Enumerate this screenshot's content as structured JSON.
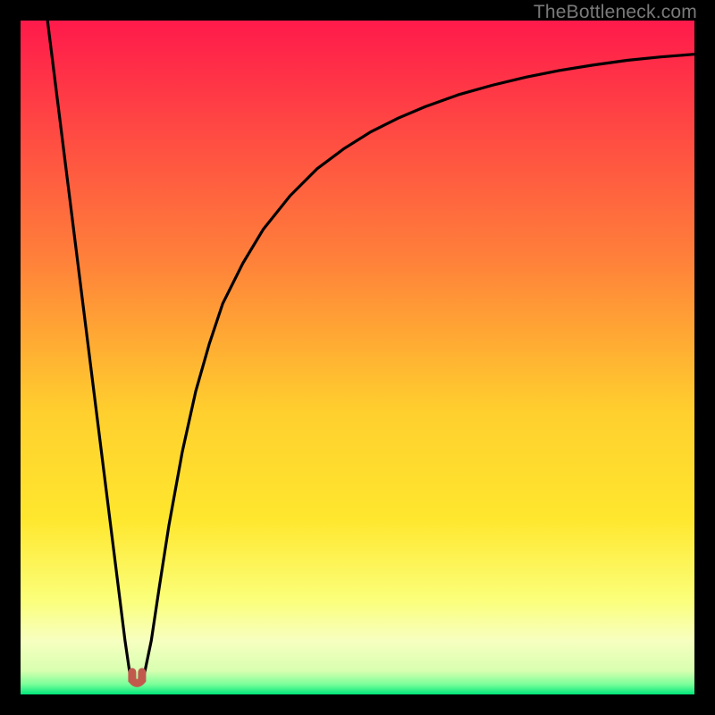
{
  "watermark": "TheBottleneck.com",
  "colors": {
    "bg_black": "#000000",
    "grad_top": "#ff1a4b",
    "grad_orange": "#ff7f3a",
    "grad_yellow": "#ffe72e",
    "grad_lightyellow": "#fbff7a",
    "grad_paleyellow": "#f7ffc0",
    "grad_green": "#00e67a",
    "curve_stroke": "#000000",
    "marker_fill": "#c15a4d",
    "marker_stroke": "#c15a4d",
    "watermark": "#7a7a7a"
  },
  "chart_data": {
    "type": "line",
    "title": "",
    "xlabel": "",
    "ylabel": "",
    "xlim": [
      0,
      100
    ],
    "ylim": [
      0,
      100
    ],
    "x": [
      4,
      6,
      8,
      10,
      12,
      14,
      15.5,
      16.2,
      17,
      17.7,
      18.4,
      19.4,
      20.6,
      22,
      24,
      26,
      28,
      30,
      33,
      36,
      40,
      44,
      48,
      52,
      56,
      60,
      65,
      70,
      75,
      80,
      85,
      90,
      95,
      100
    ],
    "y": [
      100,
      84,
      68,
      52,
      36,
      20,
      8,
      3.2,
      1.6,
      1.6,
      3.2,
      8,
      16,
      25,
      36,
      45,
      52,
      58,
      64,
      69,
      74,
      78,
      81,
      83.5,
      85.5,
      87.2,
      89,
      90.4,
      91.6,
      92.6,
      93.4,
      94.1,
      94.6,
      95
    ],
    "marker": {
      "x": 17.3,
      "y": 1.6,
      "shape": "u"
    },
    "gradient_stops": [
      {
        "pos": 0.0,
        "color": "#ff1a4b"
      },
      {
        "pos": 0.35,
        "color": "#ff7f3a"
      },
      {
        "pos": 0.58,
        "color": "#ffcf2e"
      },
      {
        "pos": 0.74,
        "color": "#ffe72e"
      },
      {
        "pos": 0.86,
        "color": "#fbff7a"
      },
      {
        "pos": 0.92,
        "color": "#f7ffc0"
      },
      {
        "pos": 0.965,
        "color": "#d8ffb0"
      },
      {
        "pos": 0.985,
        "color": "#7aff9a"
      },
      {
        "pos": 1.0,
        "color": "#00e67a"
      }
    ]
  }
}
